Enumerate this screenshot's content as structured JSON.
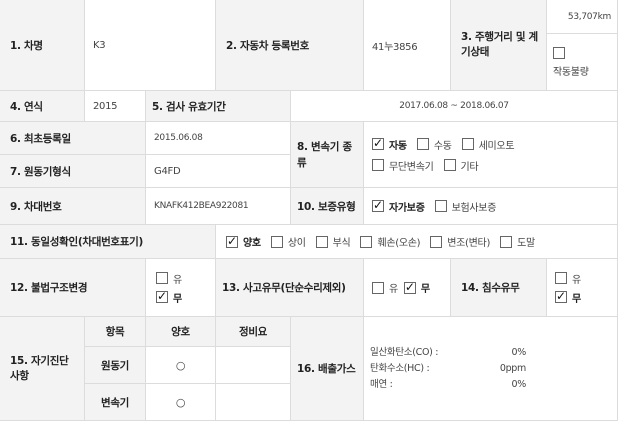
{
  "r1": {
    "name_label": "1. 차명",
    "name_value": "K3",
    "reg_label": "2. 자동차 등록번호",
    "reg_value": "41누3856",
    "mileage_label": "3. 주행거리 및 계기상태",
    "mileage_value": "53,707km",
    "meter_opt": "작동불량"
  },
  "r2": {
    "year_label": "4. 연식",
    "year_value": "2015",
    "insp_label": "5. 검사 유효기간",
    "insp_value": "2017.06.08 ~ 2018.06.07"
  },
  "r3": {
    "first_reg_label": "6. 최초등록일",
    "first_reg_value": "2015.06.08",
    "trans_label": "8. 변속기 종류",
    "trans_opts": [
      "자동",
      "수동",
      "세미오토",
      "무단변속기",
      "기타"
    ]
  },
  "r4": {
    "engine_label": "7. 원동기형식",
    "engine_value": "G4FD"
  },
  "r5": {
    "vin_label": "9. 차대번호",
    "vin_value": "KNAFK412BEA922081",
    "warranty_label": "10. 보증유형",
    "warranty_opts": [
      "자가보증",
      "보험사보증"
    ]
  },
  "r6": {
    "identity_label": "11. 동일성확인(차대번호표기)",
    "identity_opts": [
      "양호",
      "상이",
      "부식",
      "훼손(오손)",
      "변조(변타)",
      "도말"
    ]
  },
  "r7": {
    "illegal_label": "12. 불법구조변경",
    "yes": "유",
    "no": "무",
    "accident_label": "13. 사고유무(단순수리제외)",
    "flood_label": "14. 침수유무"
  },
  "r8": {
    "diag_label": "15. 자기진단 사항",
    "col_item": "항목",
    "col_good": "양호",
    "col_repair": "정비요",
    "item_engine": "원동기",
    "item_trans": "변속기",
    "circle": "○",
    "emission_label": "16. 배출가스",
    "co_label": "일산화탄소(CO) :",
    "co_value": "0%",
    "hc_label": "탄화수소(HC) :",
    "hc_value": "0ppm",
    "smoke_label": "매연 :",
    "smoke_value": "0%"
  }
}
